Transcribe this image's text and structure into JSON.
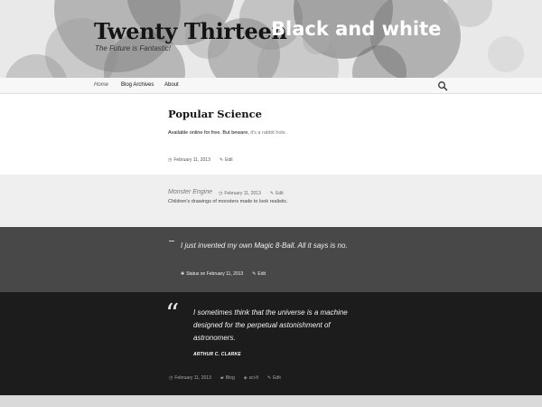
{
  "header": {
    "site_title": "Twenty Thirteen",
    "overlay_title": "Black and white",
    "site_description": "The Future is Fantastic!"
  },
  "nav": {
    "items": [
      {
        "label": "Home"
      },
      {
        "label": "Blog Archives"
      },
      {
        "label": "About"
      }
    ],
    "search_icon": "search-icon"
  },
  "posts": [
    {
      "title": "Popular Science",
      "body_text": "Available online for free. But beware, ",
      "body_link": "it's a rabbit hole.",
      "date": "February 11, 2013",
      "edit_label": "Edit"
    },
    {
      "title": "Monster Engine",
      "date": "February 11, 2013",
      "edit_label": "Edit",
      "body": "Children's drawings of monsters made to look realistic."
    },
    {
      "status_text": "I just invented my own Magic 8-Ball. All it says is no.",
      "status_label": "Status on February 11, 2013",
      "edit_label": "Edit"
    },
    {
      "quote": "I sometimes think that the universe is a machine designed for the perpetual astonishment of astronomers.",
      "author": "ARTHUR C. CLARKE",
      "date": "February 11, 2013",
      "category": "Blog",
      "tag": "sci-fi",
      "edit_label": "Edit"
    }
  ]
}
